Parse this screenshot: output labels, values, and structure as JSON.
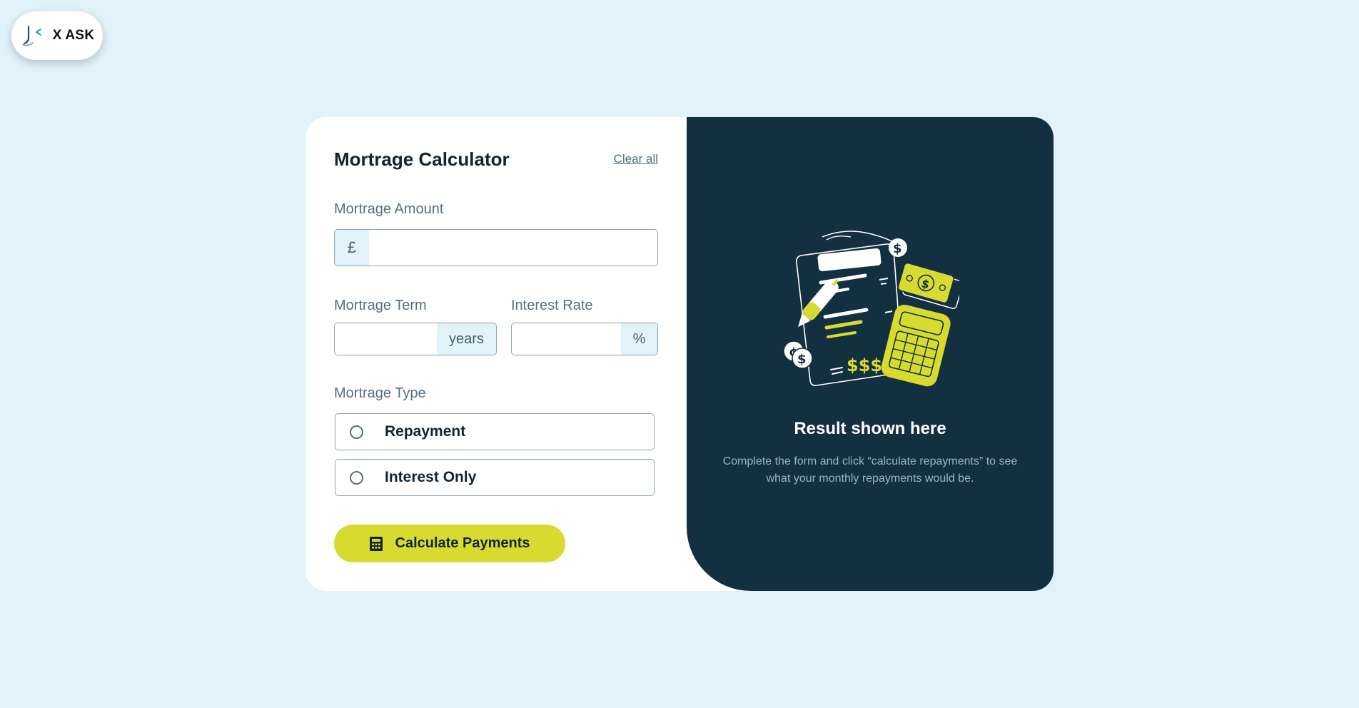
{
  "xask_button": {
    "label": "X ASK",
    "icon": "x-ask-logo-icon"
  },
  "form": {
    "title": "Mortrage Calculator",
    "clear_all": "Clear all",
    "amount": {
      "label": "Mortrage Amount",
      "prefix": "£",
      "value": "",
      "placeholder": ""
    },
    "term": {
      "label": "Mortrage Term",
      "suffix": "years",
      "value": "",
      "placeholder": ""
    },
    "rate": {
      "label": "Interest Rate",
      "suffix": "%",
      "value": "",
      "placeholder": ""
    },
    "type": {
      "label": "Mortrage Type",
      "options": [
        {
          "label": "Repayment",
          "selected": false
        },
        {
          "label": "Interest Only",
          "selected": false
        }
      ]
    },
    "submit": {
      "label": "Calculate Payments",
      "icon": "calculator-icon"
    }
  },
  "result": {
    "illustration": "empty-result-illustration",
    "title": "Result shown here",
    "text": "Complete the form and click “calculate repayments” to see what your monthly repayments would be."
  },
  "colors": {
    "page_background": "#e2f2fa",
    "result_panel": "#133041",
    "accent_lime": "#d8db2f",
    "text_dark": "#14232d",
    "text_muted": "#55707f",
    "addon_background": "#e2f2fa"
  }
}
